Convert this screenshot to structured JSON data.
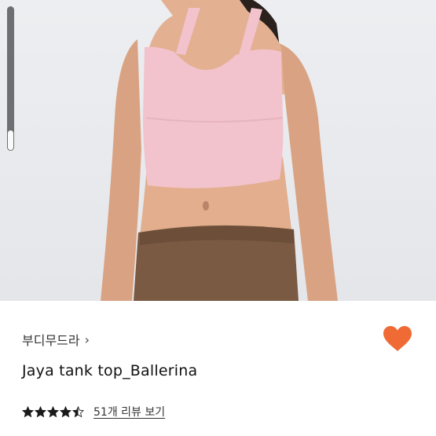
{
  "product": {
    "brand_label": "부디무드라",
    "brand_chevron": "›",
    "title": "Jaya tank top_Ballerina",
    "rating_value": 4.5,
    "rating_max": 5,
    "review_link": "51개 리뷰 보기"
  },
  "gallery": {
    "scroll_fraction": 0.14
  },
  "colors": {
    "heart": "#f06a35",
    "star": "#1a1a1a",
    "top": "#f2c3cd",
    "pants": "#7a5a42",
    "skin": "#e0ac8c"
  },
  "icons": {
    "favorite": "heart-icon",
    "brand_nav": "chevron-right-icon",
    "rating": "star-icon"
  }
}
